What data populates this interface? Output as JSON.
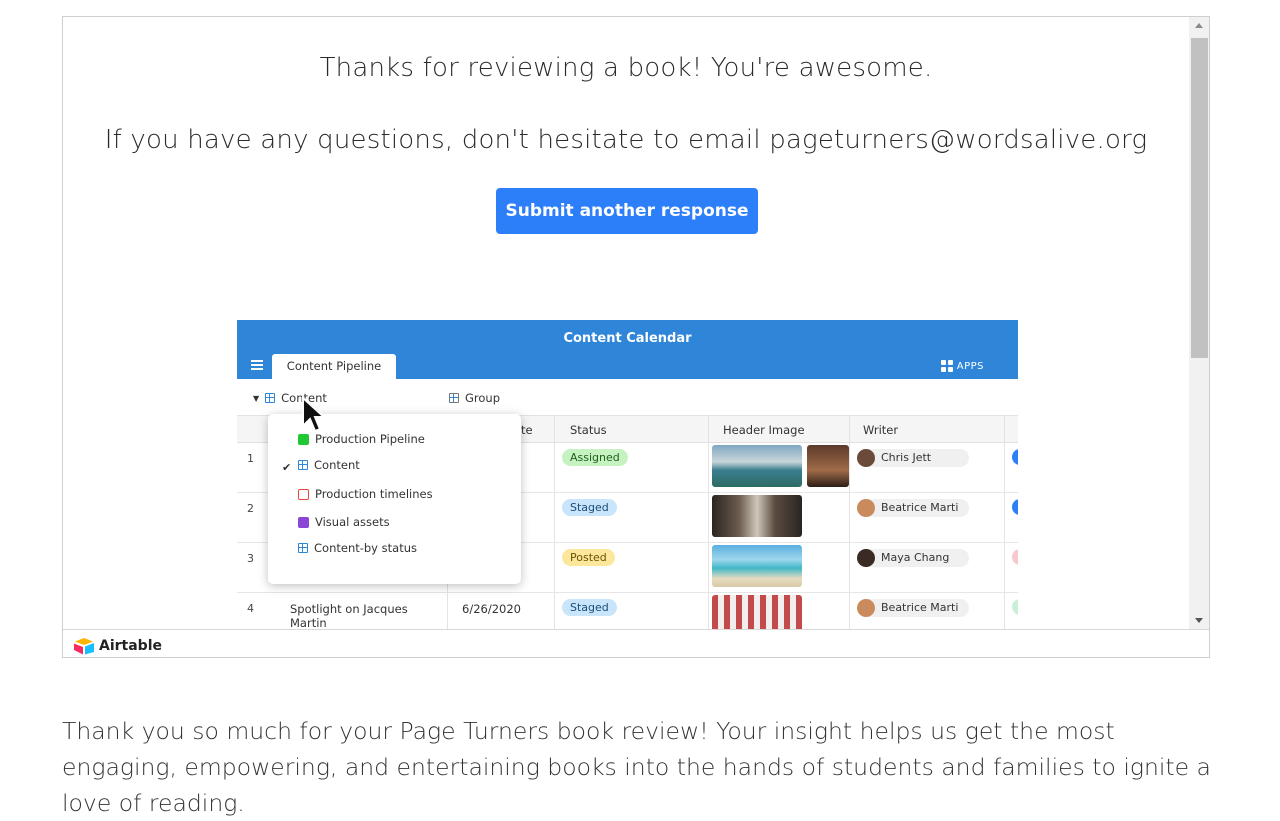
{
  "form": {
    "thanks_line": "Thanks for reviewing a book! You're awesome.",
    "email_line": "If you have any questions, don't hesitate to email pageturners@wordsalive.org",
    "submit_another_label": "Submit another response"
  },
  "screenshot": {
    "title": "Content Calendar",
    "active_tab": "Content Pipeline",
    "apps_label": "APPS",
    "toolbar": {
      "view_label": "Content",
      "group_label": "Group"
    },
    "columns": [
      "te",
      "Status",
      "Header Image",
      "Writer"
    ],
    "menu_items": [
      {
        "label": "Production Pipeline",
        "icon": "kanban-icon"
      },
      {
        "label": "Content",
        "icon": "grid-icon",
        "checked": true
      },
      {
        "label": "Production timelines",
        "icon": "gantt-icon"
      },
      {
        "label": "Visual assets",
        "icon": "gallery-icon"
      },
      {
        "label": "Content-by status",
        "icon": "grid-icon"
      }
    ],
    "rows": [
      {
        "num": "1",
        "status": "Assigned",
        "writer": "Chris Jett"
      },
      {
        "num": "2",
        "status": "Staged",
        "writer": "Beatrice Marti"
      },
      {
        "num": "3",
        "status": "Posted",
        "writer": "Maya Chang"
      },
      {
        "num": "4",
        "title_line1": "Spotlight on Jacques",
        "title_line2": "Martin",
        "date": "6/26/2020",
        "status": "Staged",
        "writer": "Beatrice Marti"
      }
    ],
    "colors": {
      "header": "#2f86d8",
      "assigned": "#c5f2c0",
      "staged": "#c8e5fb",
      "posted": "#fde79c"
    }
  },
  "footer": {
    "brand": "Airtable"
  },
  "page": {
    "body_text": "Thank you so much for your Page Turners book review! Your insight helps us get the most engaging, empowering, and entertaining books into the hands of students and families to ignite a love of reading."
  }
}
